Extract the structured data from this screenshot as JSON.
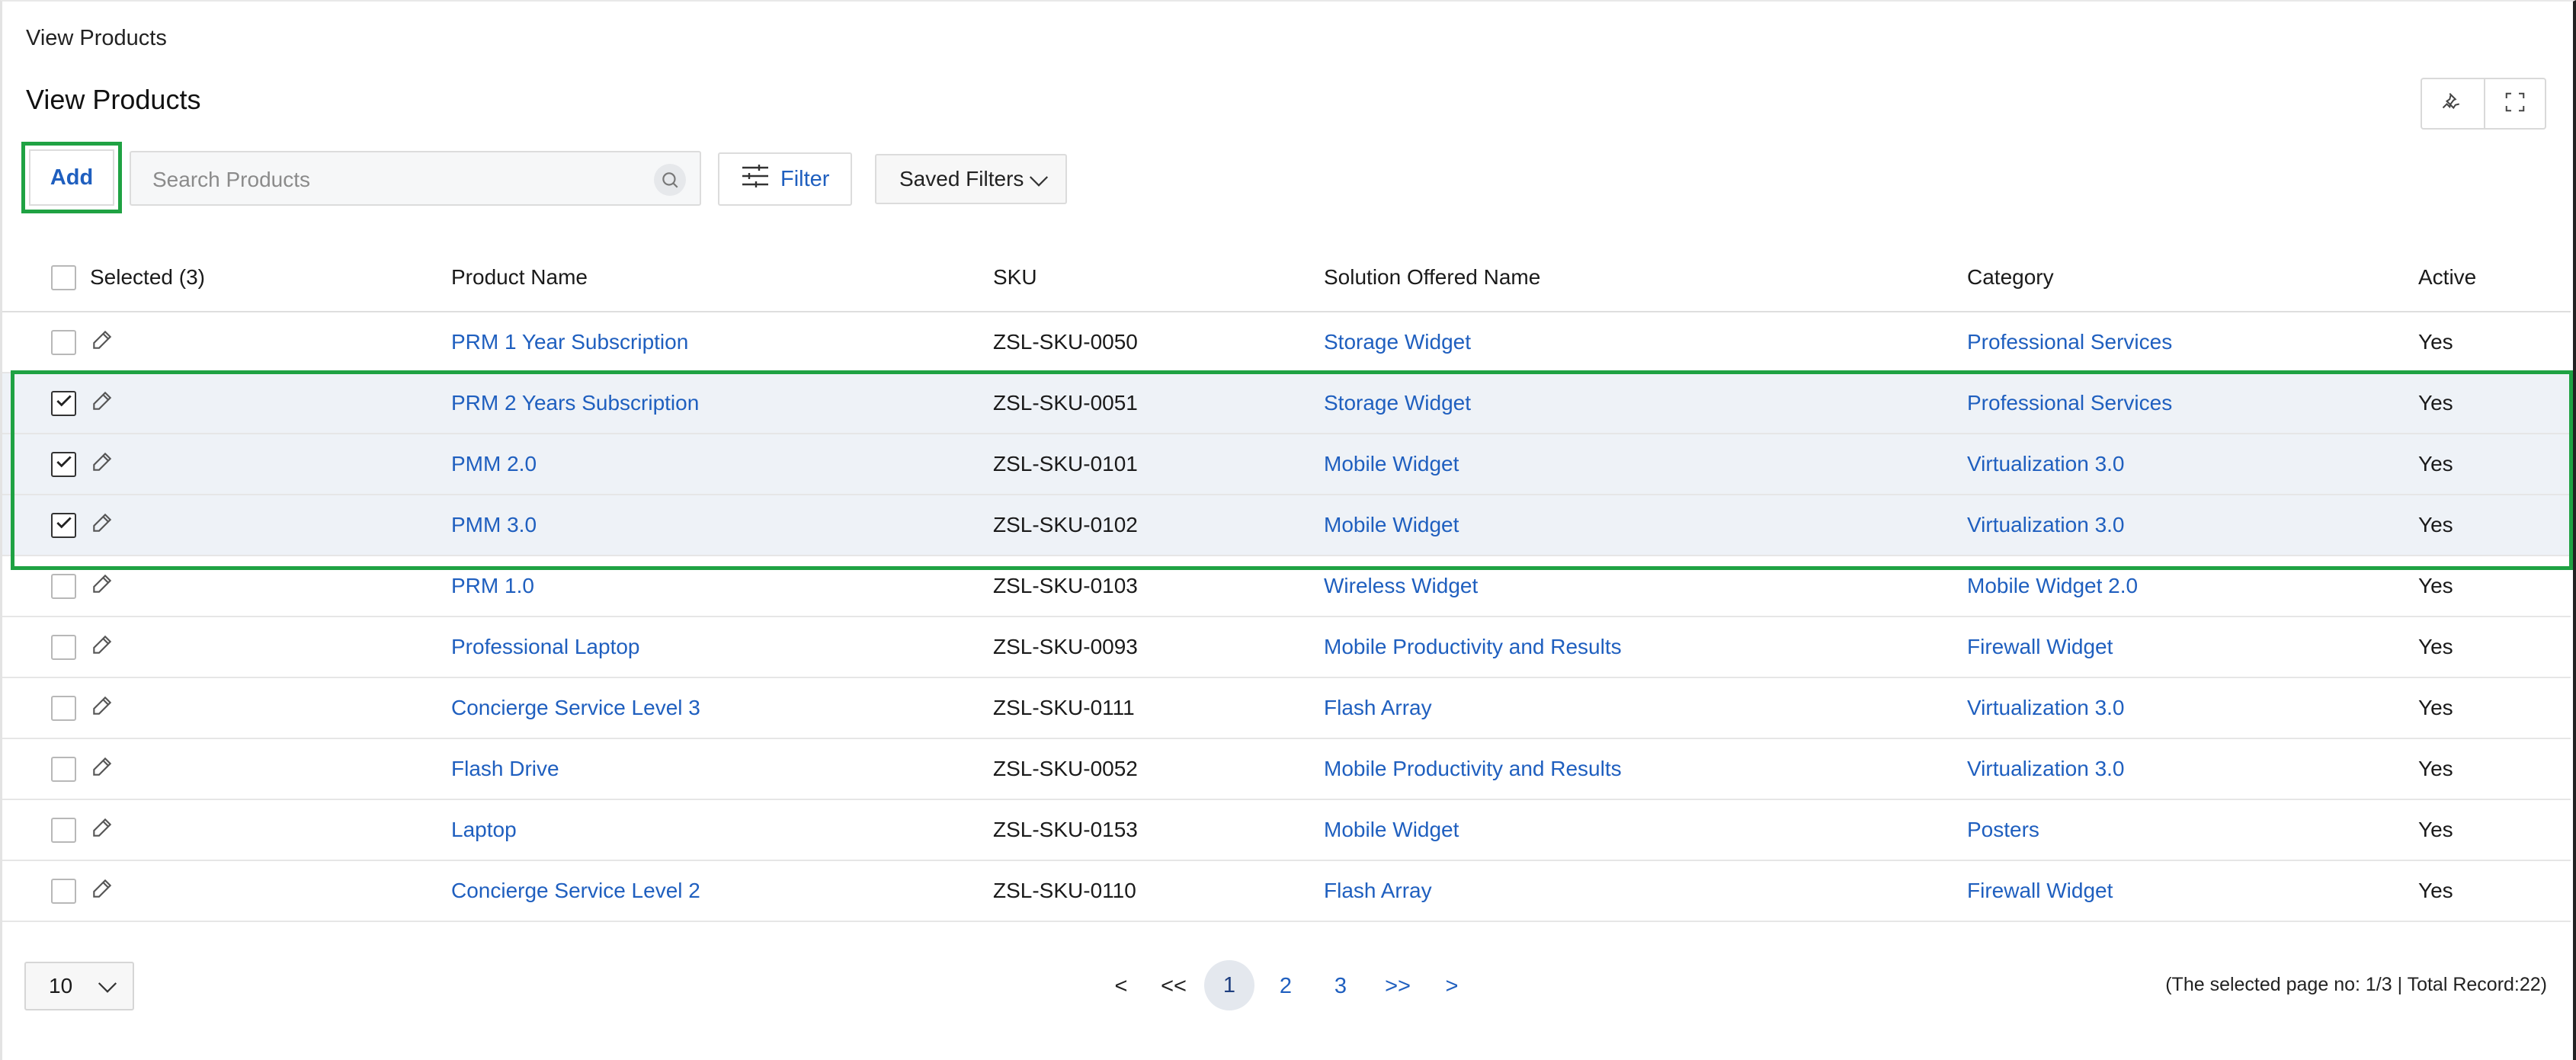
{
  "breadcrumb": "View Products",
  "page_title": "View Products",
  "toolbar": {
    "add_label": "Add",
    "search_placeholder": "Search Products",
    "filter_label": "Filter",
    "saved_filters_label": "Saved Filters"
  },
  "table": {
    "columns": {
      "selected": "Selected (3)",
      "product_name": "Product Name",
      "sku": "SKU",
      "solution": "Solution Offered Name",
      "category": "Category",
      "active": "Active"
    },
    "rows": [
      {
        "name": "PRM 1 Year Subscription",
        "sku": "ZSL-SKU-0050",
        "solution": "Storage Widget",
        "category": "Professional Services",
        "active": "Yes",
        "checked": false
      },
      {
        "name": "PRM 2 Years Subscription",
        "sku": "ZSL-SKU-0051",
        "solution": "Storage Widget",
        "category": "Professional Services",
        "active": "Yes",
        "checked": true
      },
      {
        "name": "PMM 2.0",
        "sku": "ZSL-SKU-0101",
        "solution": "Mobile Widget",
        "category": "Virtualization 3.0",
        "active": "Yes",
        "checked": true
      },
      {
        "name": "PMM 3.0",
        "sku": "ZSL-SKU-0102",
        "solution": "Mobile Widget",
        "category": "Virtualization 3.0",
        "active": "Yes",
        "checked": true
      },
      {
        "name": "PRM 1.0",
        "sku": "ZSL-SKU-0103",
        "solution": "Wireless Widget",
        "category": "Mobile Widget 2.0",
        "active": "Yes",
        "checked": false
      },
      {
        "name": "Professional Laptop",
        "sku": "ZSL-SKU-0093",
        "solution": "Mobile Productivity and Results",
        "category": "Firewall Widget",
        "active": "Yes",
        "checked": false
      },
      {
        "name": "Concierge Service Level 3",
        "sku": "ZSL-SKU-0111",
        "solution": "Flash Array",
        "category": "Virtualization 3.0",
        "active": "Yes",
        "checked": false
      },
      {
        "name": "Flash Drive",
        "sku": "ZSL-SKU-0052",
        "solution": "Mobile Productivity and Results",
        "category": "Virtualization 3.0",
        "active": "Yes",
        "checked": false
      },
      {
        "name": "Laptop",
        "sku": "ZSL-SKU-0153",
        "solution": "Mobile Widget",
        "category": "Posters",
        "active": "Yes",
        "checked": false
      },
      {
        "name": "Concierge Service Level 2",
        "sku": "ZSL-SKU-0110",
        "solution": "Flash Array",
        "category": "Firewall Widget",
        "active": "Yes",
        "checked": false
      }
    ]
  },
  "pagination": {
    "page_size": "10",
    "prev": "<",
    "first": "<<",
    "pages": [
      "1",
      "2",
      "3"
    ],
    "current_page": "1",
    "last": ">>",
    "next": ">",
    "summary": "(The selected page no: 1/3 | Total Record:22)"
  },
  "icons": {
    "pin": "pin-icon",
    "expand": "expand-icon",
    "search": "search-icon",
    "filter": "sliders-icon",
    "dropdown": "chevron-down-icon",
    "edit": "pencil-icon",
    "check": "checkmark-icon"
  },
  "colors": {
    "link": "#1f5fbf",
    "highlight": "#1fa243",
    "selected_row_bg": "#eef2f7"
  }
}
